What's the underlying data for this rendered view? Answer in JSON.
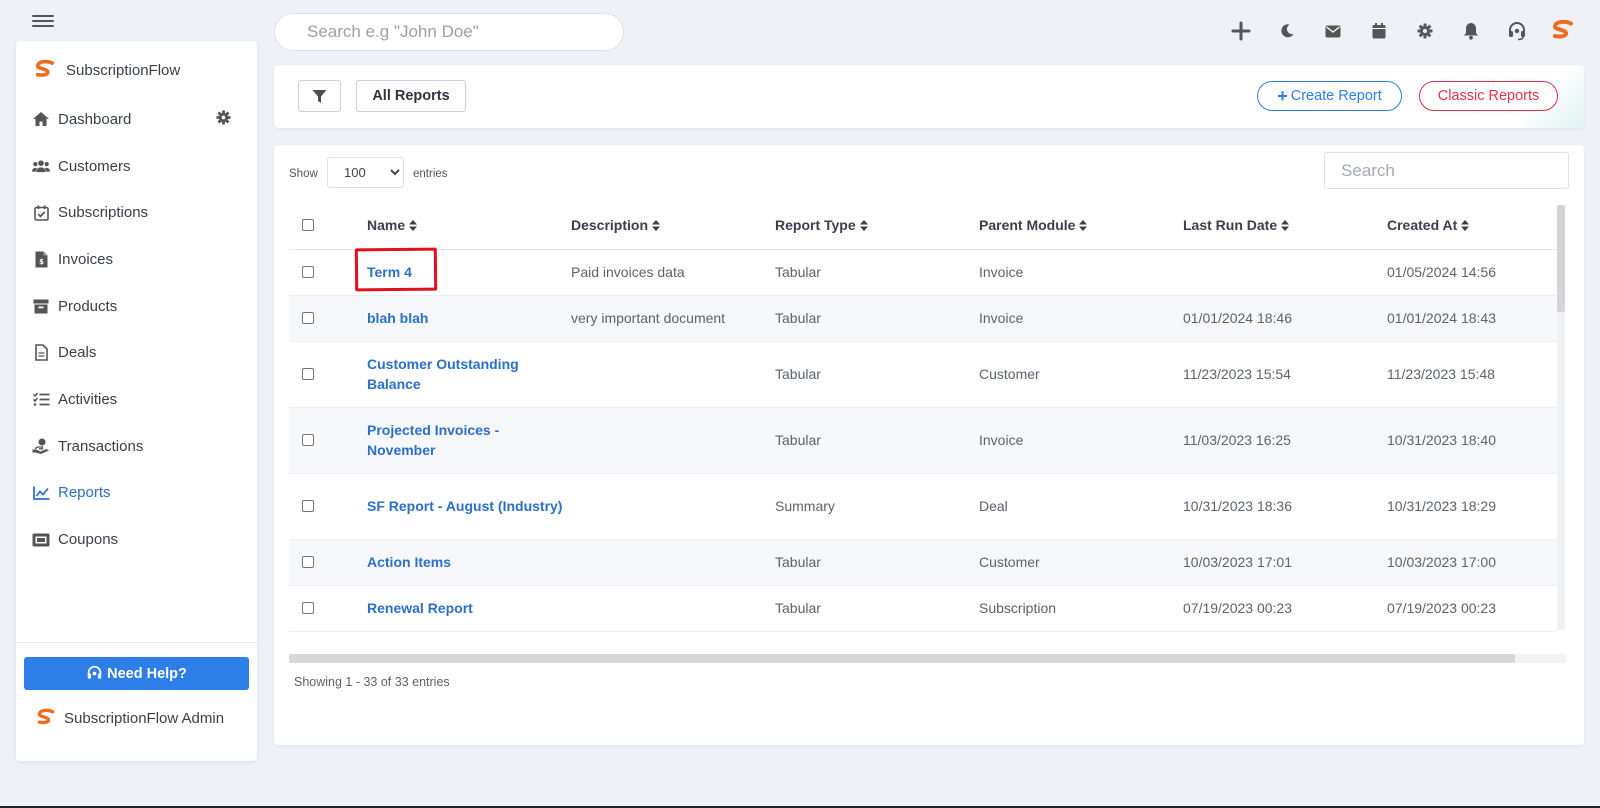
{
  "header": {
    "search_placeholder": "Search e.g \"John Doe\"",
    "icons": [
      "plus-icon",
      "moon-icon",
      "mail-icon",
      "calendar-icon",
      "gear-icon",
      "bell-icon",
      "headset-icon",
      "brand-logo-icon"
    ]
  },
  "sidebar": {
    "brand": "SubscriptionFlow",
    "items": [
      {
        "label": "Dashboard",
        "icon": "home-icon"
      },
      {
        "label": "Customers",
        "icon": "users-icon"
      },
      {
        "label": "Subscriptions",
        "icon": "calendar-check-icon"
      },
      {
        "label": "Invoices",
        "icon": "invoice-icon"
      },
      {
        "label": "Products",
        "icon": "archive-icon"
      },
      {
        "label": "Deals",
        "icon": "file-icon"
      },
      {
        "label": "Activities",
        "icon": "checklist-icon"
      },
      {
        "label": "Transactions",
        "icon": "hand-money-icon"
      },
      {
        "label": "Reports",
        "icon": "chart-line-icon",
        "active": true
      },
      {
        "label": "Coupons",
        "icon": "ticket-icon"
      }
    ],
    "help_label": "Need Help?",
    "admin_label": "SubscriptionFlow Admin"
  },
  "toolbar": {
    "all_reports_label": "All Reports",
    "create_label": "Create Report",
    "classic_label": "Classic Reports"
  },
  "table": {
    "show_label": "Show",
    "entries_value": "100",
    "entries_options": [
      "100"
    ],
    "entries_label": "entries",
    "search_placeholder": "Search",
    "columns": [
      "Name",
      "Description",
      "Report Type",
      "Parent Module",
      "Last Run Date",
      "Created At"
    ],
    "rows": [
      {
        "name": "Term 4",
        "description": "Paid invoices data",
        "type": "Tabular",
        "module": "Invoice",
        "last_run": "",
        "created": "01/05/2024 14:56"
      },
      {
        "name": "blah blah",
        "description": "very important document",
        "type": "Tabular",
        "module": "Invoice",
        "last_run": "01/01/2024 18:46",
        "created": "01/01/2024 18:43"
      },
      {
        "name": "Customer Outstanding Balance",
        "description": "",
        "type": "Tabular",
        "module": "Customer",
        "last_run": "11/23/2023 15:54",
        "created": "11/23/2023 15:48"
      },
      {
        "name": "Projected Invoices - November",
        "description": "",
        "type": "Tabular",
        "module": "Invoice",
        "last_run": "11/03/2023 16:25",
        "created": "10/31/2023 18:40"
      },
      {
        "name": "SF Report - August (Industry)",
        "description": "",
        "type": "Summary",
        "module": "Deal",
        "last_run": "10/31/2023 18:36",
        "created": "10/31/2023 18:29"
      },
      {
        "name": "Action Items",
        "description": "",
        "type": "Tabular",
        "module": "Customer",
        "last_run": "10/03/2023 17:01",
        "created": "10/03/2023 17:00"
      },
      {
        "name": "Renewal Report",
        "description": "",
        "type": "Tabular",
        "module": "Subscription",
        "last_run": "07/19/2023 00:23",
        "created": "07/19/2023 00:23"
      }
    ],
    "showing_text": "Showing 1 - 33 of 33 entries"
  },
  "colors": {
    "accent": "#2d7ee6",
    "link": "#2a6fc9",
    "danger": "#e0304c",
    "brand_orange": "#f26b21",
    "highlight": "#e0101e"
  }
}
